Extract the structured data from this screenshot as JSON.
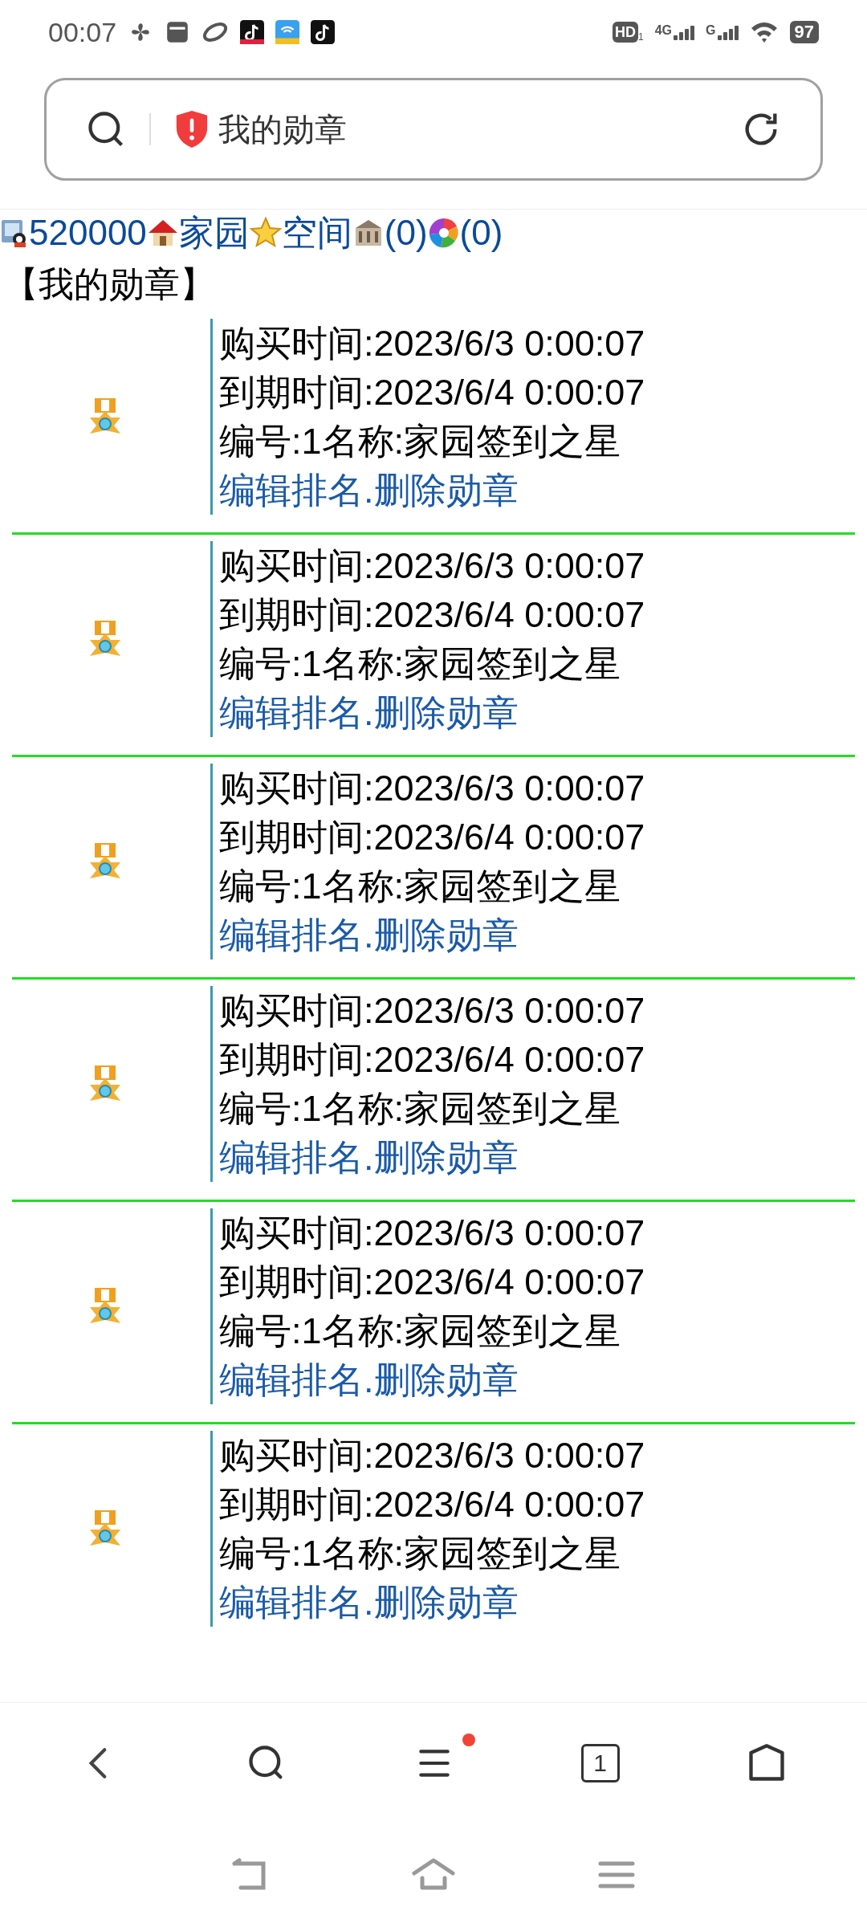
{
  "status_bar": {
    "time": "00:07",
    "hd": "HD",
    "hd_sub": "1",
    "sim1": "4G",
    "sim2": "G",
    "battery": "97"
  },
  "address_bar": {
    "title": "我的勋章"
  },
  "nav_links": [
    {
      "kind": "user",
      "text": "520000"
    },
    {
      "kind": "home",
      "text": "家园"
    },
    {
      "kind": "star",
      "text": "空间"
    },
    {
      "kind": "building",
      "text": "(0)"
    },
    {
      "kind": "aperture",
      "text": "(0)"
    }
  ],
  "heading": "【我的勋章】",
  "medals": [
    {
      "purchase": "购买时间:2023/6/3 0:00:07",
      "expiry": "到期时间:2023/6/4 0:00:07",
      "info": "编号:1名称:家园签到之星",
      "edit": "编辑排名",
      "separator": ".",
      "delete": "删除勋章"
    },
    {
      "purchase": "购买时间:2023/6/3 0:00:07",
      "expiry": "到期时间:2023/6/4 0:00:07",
      "info": "编号:1名称:家园签到之星",
      "edit": "编辑排名",
      "separator": ".",
      "delete": "删除勋章"
    },
    {
      "purchase": "购买时间:2023/6/3 0:00:07",
      "expiry": "到期时间:2023/6/4 0:00:07",
      "info": "编号:1名称:家园签到之星",
      "edit": "编辑排名",
      "separator": ".",
      "delete": "删除勋章"
    },
    {
      "purchase": "购买时间:2023/6/3 0:00:07",
      "expiry": "到期时间:2023/6/4 0:00:07",
      "info": "编号:1名称:家园签到之星",
      "edit": "编辑排名",
      "separator": ".",
      "delete": "删除勋章"
    },
    {
      "purchase": "购买时间:2023/6/3 0:00:07",
      "expiry": "到期时间:2023/6/4 0:00:07",
      "info": "编号:1名称:家园签到之星",
      "edit": "编辑排名",
      "separator": ".",
      "delete": "删除勋章"
    },
    {
      "purchase": "购买时间:2023/6/3 0:00:07",
      "expiry": "到期时间:2023/6/4 0:00:07",
      "info": "编号:1名称:家园签到之星",
      "edit": "编辑排名",
      "separator": ".",
      "delete": "删除勋章"
    }
  ],
  "bottom_toolbar": {
    "menu_notification": true,
    "tab_count": "1"
  }
}
